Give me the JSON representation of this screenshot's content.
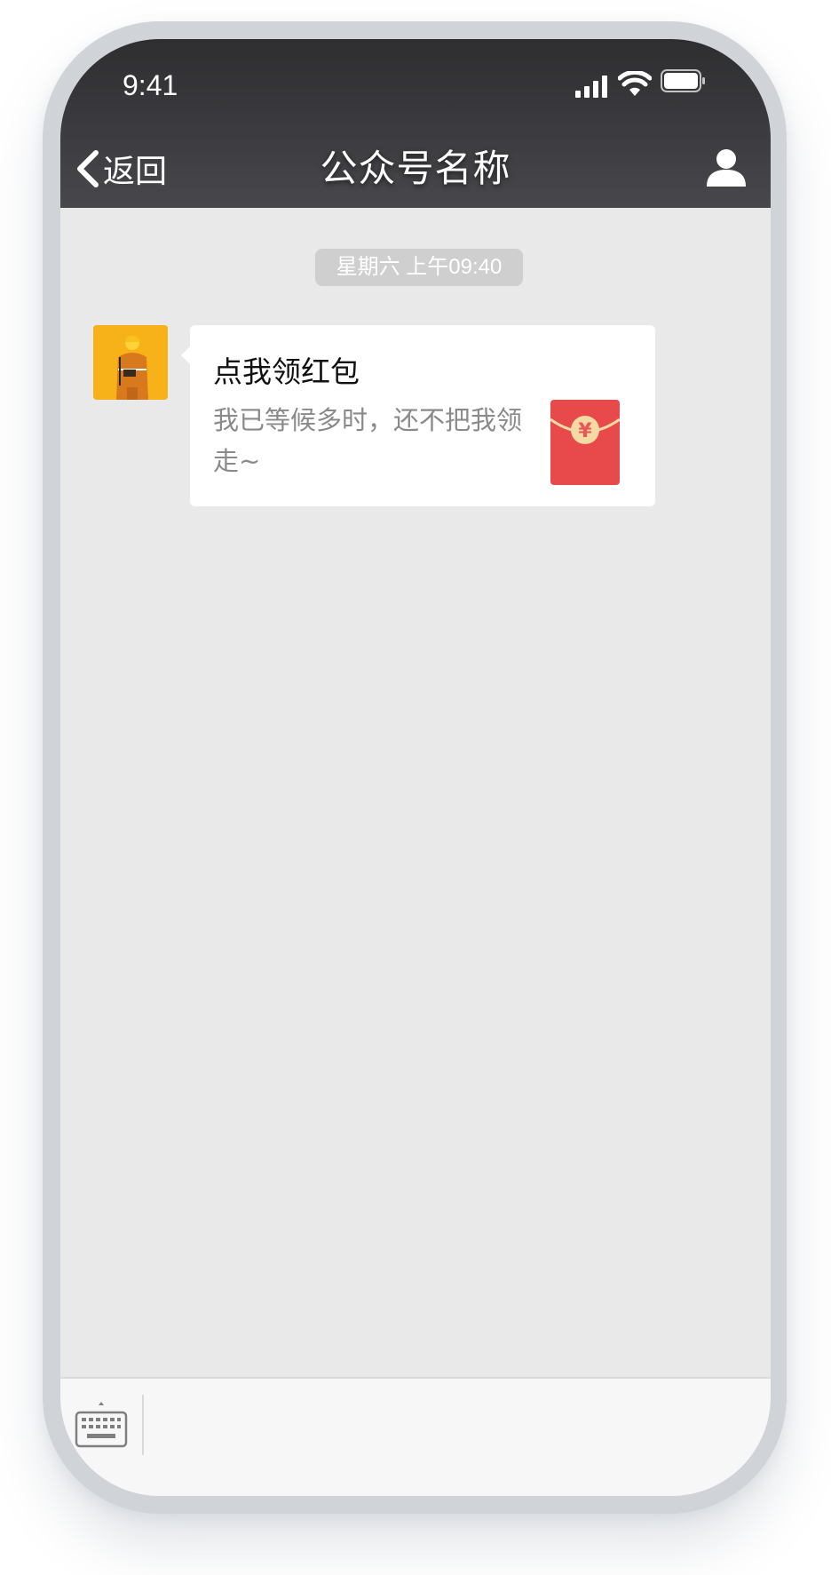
{
  "status_bar": {
    "time": "9:41",
    "signal_icon": "cellular-signal-icon",
    "wifi_icon": "wifi-icon",
    "battery_icon": "battery-icon"
  },
  "nav": {
    "back_label": "返回",
    "back_icon": "chevron-left-icon",
    "title": "公众号名称",
    "profile_icon": "person-icon"
  },
  "chat": {
    "timestamp": "星期六  上午09:40",
    "message": {
      "title": "点我领红包",
      "description": "我已等候多时，还不把我领走~",
      "packet_symbol": "¥",
      "packet_color": "#e84a4c",
      "coin_color": "#f7d9a4"
    }
  },
  "input_bar": {
    "keyboard_icon": "keyboard-icon"
  },
  "colors": {
    "nav_bg": "#3a3a3e",
    "chat_bg": "#e9e9ea",
    "frame": "#d0d3d8"
  }
}
